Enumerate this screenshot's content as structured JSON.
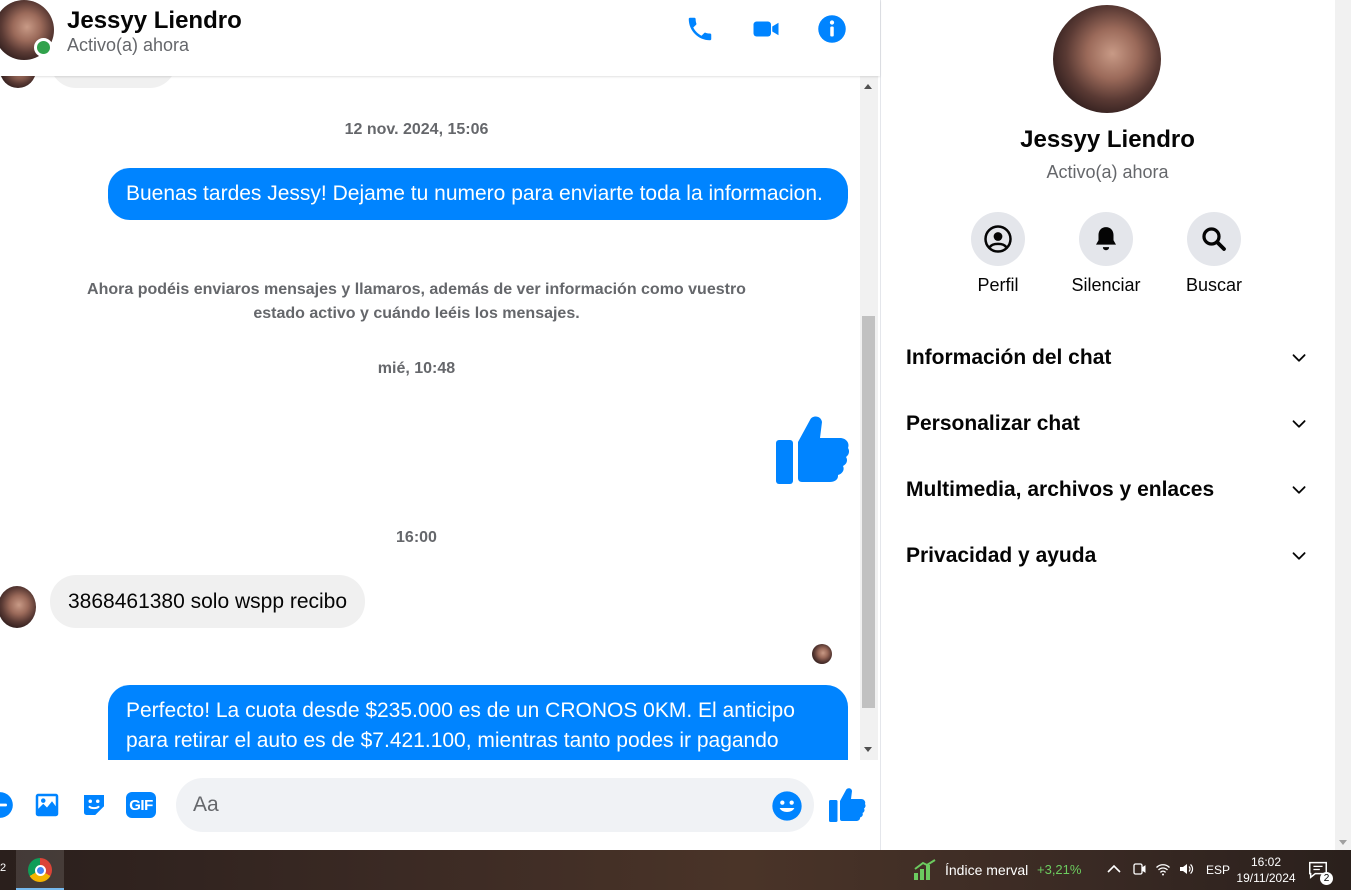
{
  "contact": {
    "name": "Jessyy Liendro",
    "status": "Activo(a) ahora"
  },
  "header": {
    "icons": [
      "phone-icon",
      "video-icon",
      "info-icon"
    ]
  },
  "messages": {
    "timestamp_1": "12 nov. 2024, 15:06",
    "outgoing_1": "Buenas tardes Jessy! Dejame tu numero para enviarte toda la informacion.",
    "notice": "Ahora podéis enviaros mensajes y llamaros, además de ver información como vuestro estado activo y cuándo leéis los mensajes.",
    "timestamp_2": "mié, 10:48",
    "timestamp_3": "16:00",
    "incoming_1": "3868461380 solo wspp recibo",
    "outgoing_2": "Perfecto! La cuota desde $235.000 es de un CRONOS 0KM. El anticipo para retirar el auto es de $7.421.100, mientras tanto podes ir pagando"
  },
  "composer": {
    "placeholder": "Aa",
    "gif_label": "GIF"
  },
  "panel": {
    "actions": [
      {
        "label": "Perfil",
        "icon": "profile-icon"
      },
      {
        "label": "Silenciar",
        "icon": "bell-icon"
      },
      {
        "label": "Buscar",
        "icon": "search-icon"
      }
    ],
    "sections": [
      {
        "label": "Información del chat"
      },
      {
        "label": "Personalizar chat"
      },
      {
        "label": "Multimedia, archivos y enlaces"
      },
      {
        "label": "Privacidad y ayuda"
      }
    ]
  },
  "taskbar": {
    "left_badge": "2",
    "stock_name": "Índice merval",
    "stock_change": "+3,21%",
    "language": "ESP",
    "time": "16:02",
    "date": "19/11/2024",
    "notification_count": "2"
  },
  "colors": {
    "accent": "#0084ff",
    "bubble_in": "#f0f0f0",
    "online": "#31a24c",
    "stock_up": "#6ccb5f"
  }
}
